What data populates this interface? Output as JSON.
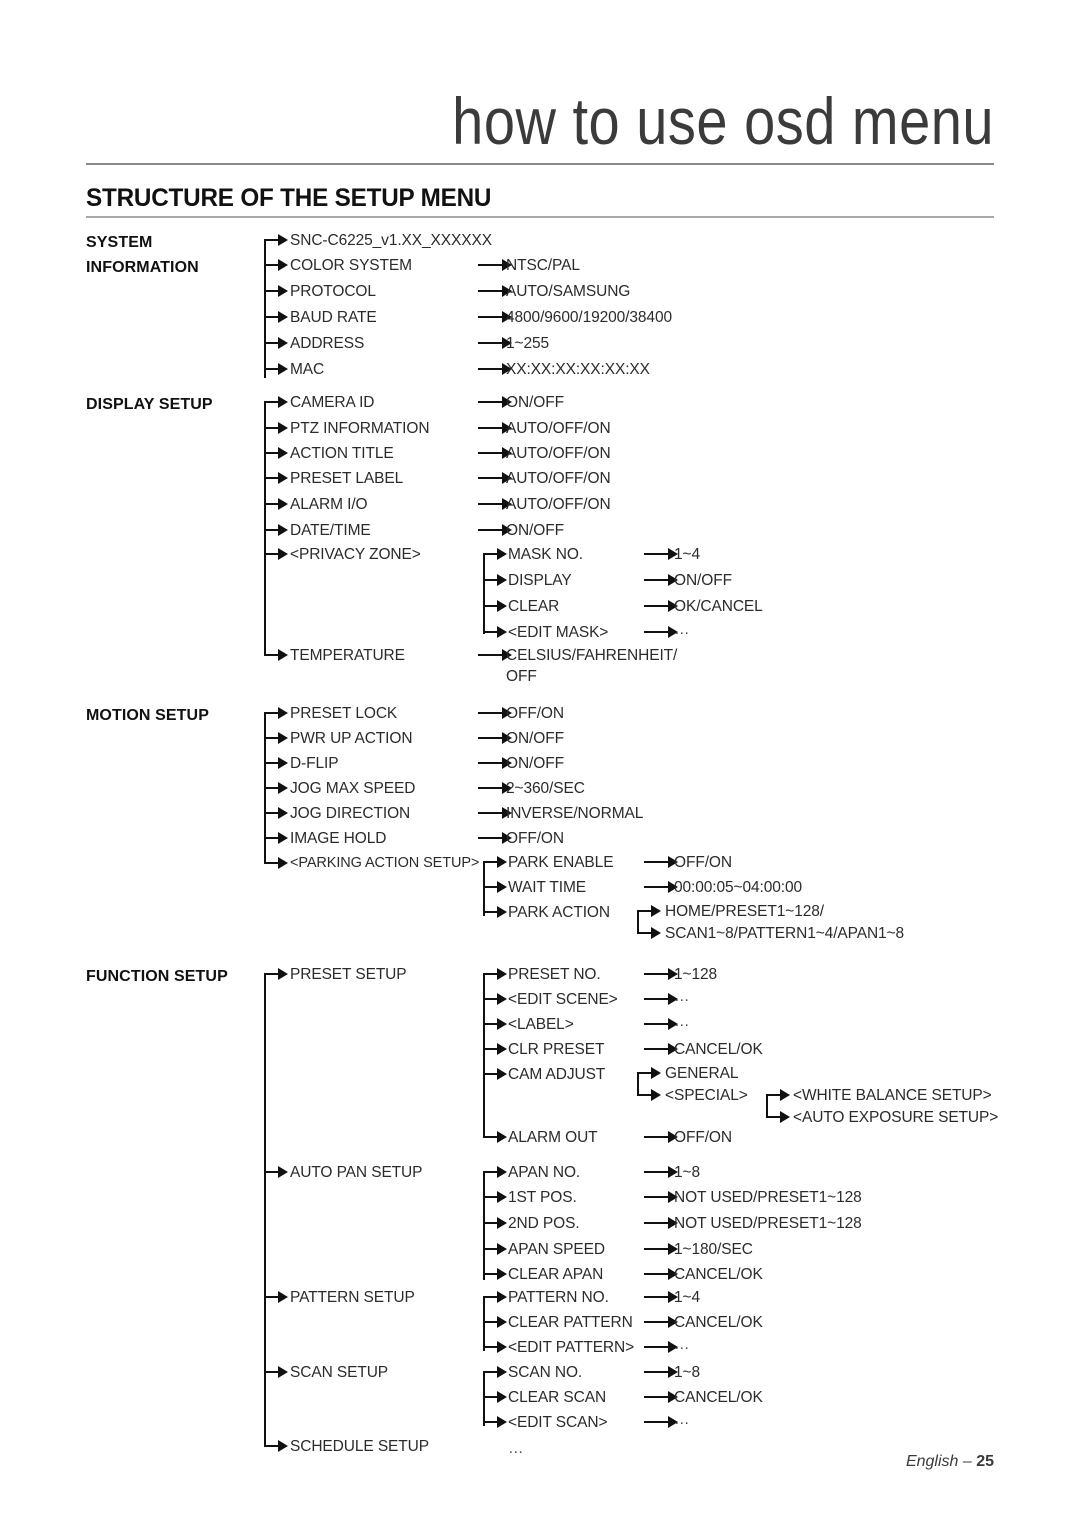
{
  "header": {
    "chapter_title": "how to use osd menu",
    "section_title": "STRUCTURE OF THE SETUP MENU"
  },
  "footer": {
    "language": "English – ",
    "page_number": "25"
  },
  "groups": {
    "system_information": {
      "line1": "SYSTEM",
      "line2": "INFORMATION"
    },
    "display_setup": {
      "line1": "DISPLAY SETUP"
    },
    "motion_setup": {
      "line1": "MOTION SETUP"
    },
    "function_setup": {
      "line1": "FUNCTION SETUP"
    }
  },
  "nodes": {
    "model": "SNC-C6225_v1.XX_XXXXXX",
    "color_system": "COLOR SYSTEM",
    "color_system_val": "NTSC/PAL",
    "protocol": "PROTOCOL",
    "protocol_val": "AUTO/SAMSUNG",
    "baud_rate": "BAUD RATE",
    "baud_rate_val": "4800/9600/19200/38400",
    "address": "ADDRESS",
    "address_val": "1~255",
    "mac": "MAC",
    "mac_val": "XX:XX:XX:XX:XX:XX",
    "camera_id": "CAMERA ID",
    "camera_id_val": "ON/OFF",
    "ptz_information": "PTZ INFORMATION",
    "ptz_information_val": "AUTO/OFF/ON",
    "action_title": "ACTION TITLE",
    "action_title_val": "AUTO/OFF/ON",
    "preset_label": "PRESET LABEL",
    "preset_label_val": "AUTO/OFF/ON",
    "alarm_io": "ALARM I/O",
    "alarm_io_val": "AUTO/OFF/ON",
    "date_time": "DATE/TIME",
    "date_time_val": "ON/OFF",
    "privacy_zone": "<PRIVACY ZONE>",
    "mask_no": "MASK NO.",
    "mask_no_val": "1~4",
    "display": "DISPLAY",
    "display_val": "ON/OFF",
    "clear": "CLEAR",
    "clear_val": "OK/CANCEL",
    "edit_mask": "<EDIT MASK>",
    "edit_mask_val": "…",
    "temperature": "TEMPERATURE",
    "temperature_val_1": "CELSIUS/FAHRENHEIT/",
    "temperature_val_2": "OFF",
    "preset_lock": "PRESET LOCK",
    "preset_lock_val": "OFF/ON",
    "pwr_up_action": "PWR UP ACTION",
    "pwr_up_action_val": "ON/OFF",
    "d_flip": "D-FLIP",
    "d_flip_val": "ON/OFF",
    "jog_max_speed": "JOG MAX SPEED",
    "jog_max_speed_val": "2~360/SEC",
    "jog_direction": "JOG DIRECTION",
    "jog_direction_val": "INVERSE/NORMAL",
    "image_hold": "IMAGE HOLD",
    "image_hold_val": "OFF/ON",
    "parking_action_setup": "<PARKING ACTION SETUP>",
    "park_enable": "PARK ENABLE",
    "park_enable_val": "OFF/ON",
    "wait_time": "WAIT TIME",
    "wait_time_val": "00:00:05~04:00:00",
    "park_action": "PARK ACTION",
    "park_action_val_1": "HOME/PRESET1~128/",
    "park_action_val_2": "SCAN1~8/PATTERN1~4/APAN1~8",
    "preset_setup": "PRESET SETUP",
    "preset_no": "PRESET NO.",
    "preset_no_val": "1~128",
    "edit_scene": "<EDIT SCENE>",
    "edit_scene_val": "…",
    "label": "<LABEL>",
    "label_val": "…",
    "clr_preset": "CLR PRESET",
    "clr_preset_val": "CANCEL/OK",
    "cam_adjust": "CAM ADJUST",
    "cam_adjust_val_1": "GENERAL",
    "cam_adjust_val_2": "<SPECIAL>",
    "white_balance_setup": "<WHITE BALANCE SETUP>",
    "auto_exposure_setup": "<AUTO EXPOSURE SETUP>",
    "alarm_out": "ALARM OUT",
    "alarm_out_val": "OFF/ON",
    "auto_pan_setup": "AUTO PAN SETUP",
    "apan_no": "APAN NO.",
    "apan_no_val": "1~8",
    "first_pos": "1ST POS.",
    "first_pos_val": "NOT USED/PRESET1~128",
    "second_pos": "2ND POS.",
    "second_pos_val": "NOT USED/PRESET1~128",
    "apan_speed": "APAN SPEED",
    "apan_speed_val": "1~180/SEC",
    "clear_apan": "CLEAR APAN",
    "clear_apan_val": "CANCEL/OK",
    "pattern_setup": "PATTERN SETUP",
    "pattern_no": "PATTERN NO.",
    "pattern_no_val": "1~4",
    "clear_pattern": "CLEAR PATTERN",
    "clear_pattern_val": "CANCEL/OK",
    "edit_pattern": "<EDIT PATTERN>",
    "edit_pattern_val": "…",
    "scan_setup": "SCAN SETUP",
    "scan_no": "SCAN NO.",
    "scan_no_val": "1~8",
    "clear_scan": "CLEAR SCAN",
    "clear_scan_val": "CANCEL/OK",
    "edit_scan": "<EDIT SCAN>",
    "edit_scan_val": "…",
    "schedule_setup": "SCHEDULE SETUP",
    "schedule_setup_val": "…"
  }
}
